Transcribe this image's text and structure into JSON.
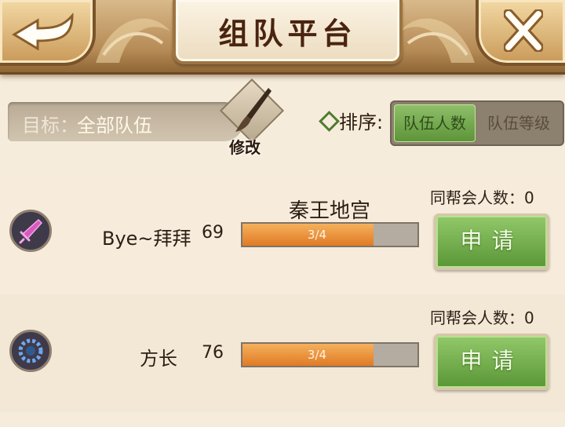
{
  "header": {
    "title": "组队平台",
    "back_icon": "back-arrow-icon",
    "close_icon": "close-icon"
  },
  "filter": {
    "target_prefix": "目标：",
    "target_value": "全部队伍",
    "edit_label": "修改",
    "edit_icon": "brush-icon"
  },
  "sort": {
    "label": "排序:",
    "options": [
      {
        "label": "队伍人数",
        "active": true
      },
      {
        "label": "队伍等级",
        "active": false
      }
    ]
  },
  "teams": [
    {
      "name": "Bye~拜拜",
      "level": "69",
      "dungeon": "秦王地宫",
      "progress_text": "3/4",
      "progress": 0.75,
      "guild_label": "同帮会人数：0",
      "apply_label": "申请",
      "emblem_icon": "sword-emblem-icon",
      "emblem_color": "#c04aa8"
    },
    {
      "name": "方长",
      "level": "76",
      "dungeon": "",
      "progress_text": "3/4",
      "progress": 0.75,
      "guild_label": "同帮会人数：0",
      "apply_label": "申请",
      "emblem_icon": "beads-emblem-icon",
      "emblem_color": "#4f8fd8"
    }
  ],
  "colors": {
    "accent_green": "#6fa845",
    "progress_orange": "#e8872f"
  }
}
